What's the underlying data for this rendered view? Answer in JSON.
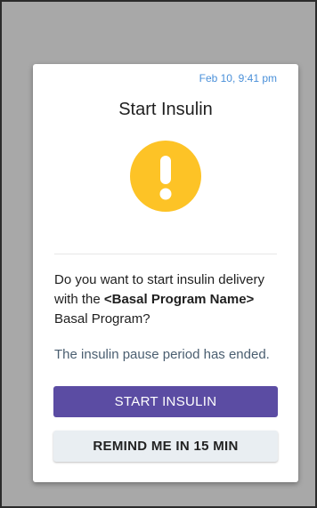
{
  "dialog": {
    "timestamp": "Feb 10, 9:41 pm",
    "title": "Start Insulin",
    "warning_icon": "exclamation-circle-icon",
    "question_prefix": "Do you want to start insulin delivery with the ",
    "question_bold": "<Basal Program Name>",
    "question_suffix": " Basal Program?",
    "info_text": "The insulin pause period has ended.",
    "primary_button_label": "START INSULIN",
    "secondary_button_label": "REMIND ME IN 15 MIN"
  },
  "colors": {
    "backdrop": "#a8a8a8",
    "accent_primary": "#5b4ca3",
    "warning": "#fdc326",
    "timestamp": "#4a90d9",
    "info_text": "#4a5e70",
    "secondary_button": "#e9eef2"
  }
}
